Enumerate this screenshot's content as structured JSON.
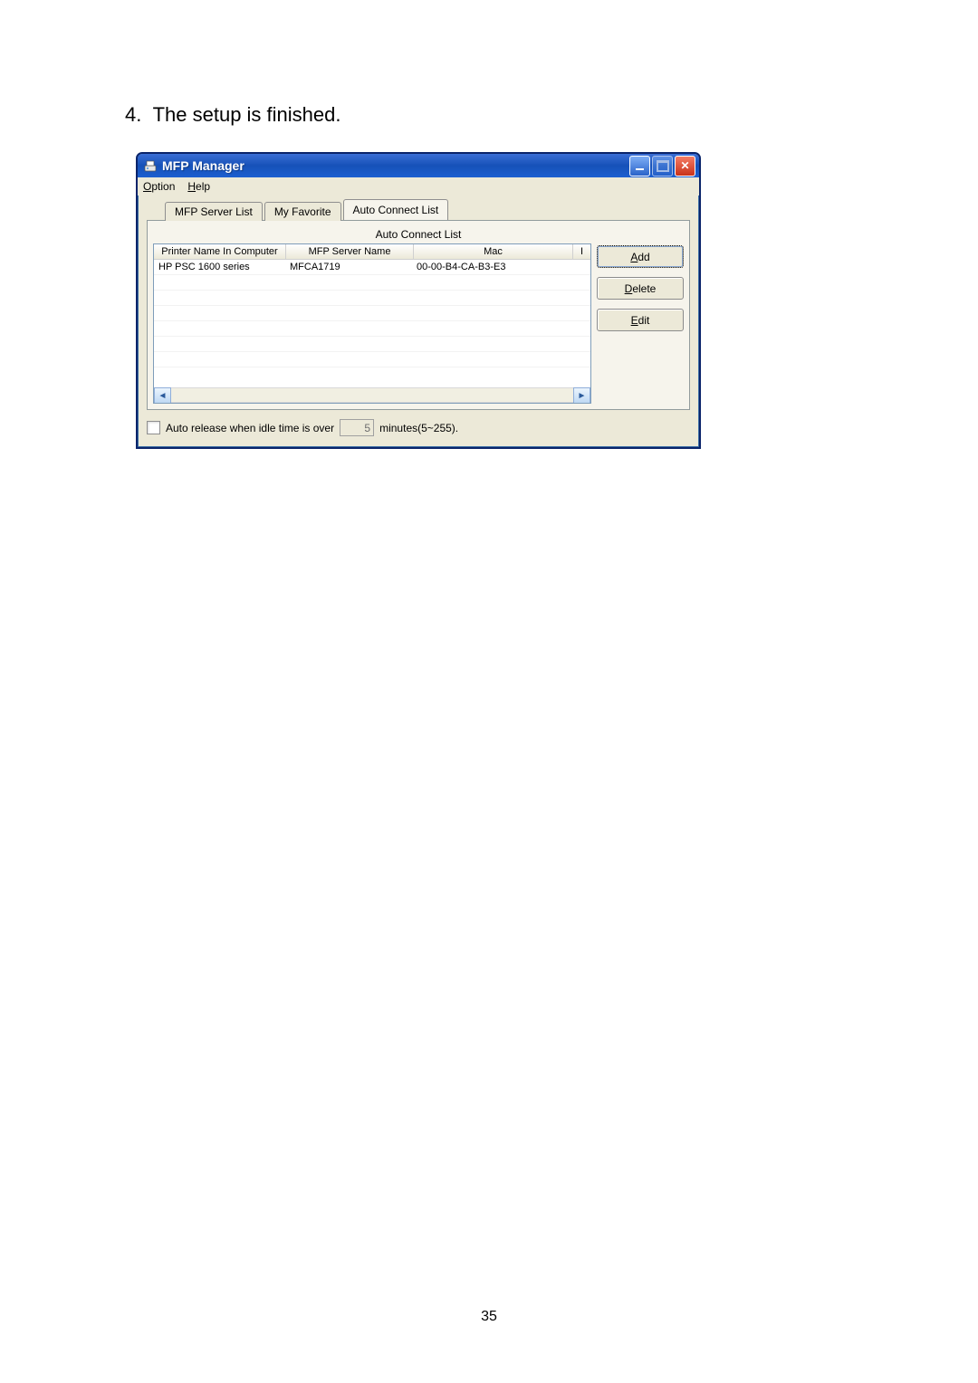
{
  "doc": {
    "caption_number": "4.",
    "caption_text": "The setup is finished.",
    "page_number": "35"
  },
  "window": {
    "title": "MFP Manager",
    "menu": {
      "option": "Option",
      "help": "Help"
    },
    "tabs": {
      "server_list": "MFP Server List",
      "my_favorite": "My Favorite",
      "auto_connect": "Auto Connect List"
    },
    "group_label": "Auto Connect List",
    "columns": {
      "printer_name": "Printer Name In Computer",
      "server_name": "MFP Server Name",
      "mac": "Mac",
      "extra": "I"
    },
    "rows": [
      {
        "printer_name": "HP PSC 1600 series",
        "server_name": "MFCA1719",
        "mac": "00-00-B4-CA-B3-E3"
      }
    ],
    "buttons": {
      "add": "Add",
      "delete": "Delete",
      "edit": "Edit"
    },
    "bottom": {
      "label": "Auto release when idle time is over",
      "value": "5",
      "suffix": "minutes(5~255)."
    }
  }
}
